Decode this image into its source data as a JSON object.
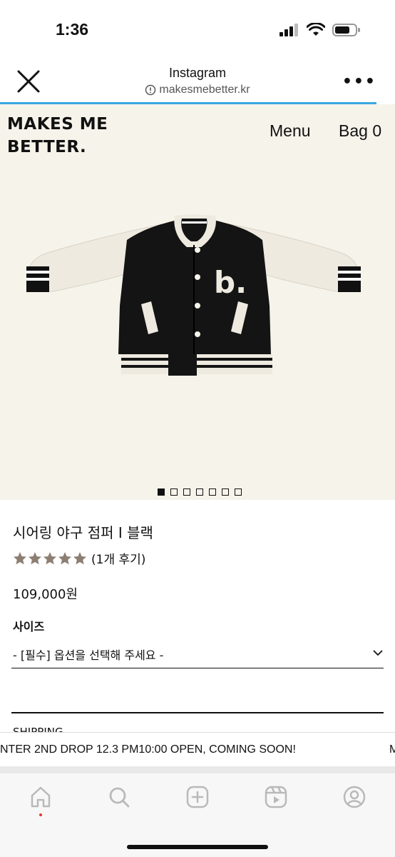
{
  "status_bar": {
    "time": "1:36"
  },
  "browser": {
    "title": "Instagram",
    "url": "makesmebetter.kr"
  },
  "site": {
    "brand": "MAKES ME\nBETTER.",
    "menu_label": "Menu",
    "bag_label": "Bag 0"
  },
  "gallery": {
    "total_images": 7,
    "active_index": 0
  },
  "product": {
    "name": "시어링 야구 점퍼 I 블랙",
    "rating": 5,
    "review_count": "(1개 후기)",
    "price": "109,000원",
    "size_label": "사이즈",
    "size_select": "- [필수] 옵션을 선택해 주세요 -",
    "shipping_label": "SHIPPING"
  },
  "banner": {
    "text": "NTER 2ND DROP 12.3 PM10:00 OPEN, COMING SOON!",
    "text_next": "M"
  },
  "colors": {
    "site_background": "#f6f3ea",
    "star": "#8c7f72",
    "loading_bar": "#39a8e0"
  },
  "bottom_nav": {
    "items": [
      "home-icon",
      "search-icon",
      "create-icon",
      "reels-icon",
      "profile-icon"
    ]
  }
}
